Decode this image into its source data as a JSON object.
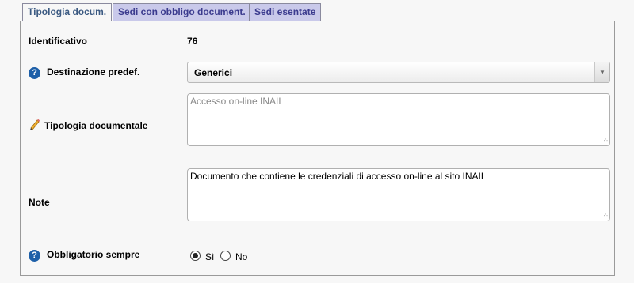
{
  "tabs": [
    {
      "label": "Tipologia docum.",
      "active": true
    },
    {
      "label": "Sedi con obbligo document.",
      "active": false
    },
    {
      "label": "Sedi esentate",
      "active": false
    }
  ],
  "form": {
    "identificativo": {
      "label": "Identificativo",
      "value": "76"
    },
    "destinazione": {
      "label": "Destinazione predef.",
      "value": "Generici",
      "help_icon": "help-icon"
    },
    "tipologia": {
      "label": "Tipologia documentale",
      "placeholder": "Accesso on-line INAIL",
      "icon": "pencil-icon"
    },
    "note": {
      "label": "Note",
      "value": "Documento che contiene le credenziali di accesso on-line al sito INAIL"
    },
    "obbligatorio": {
      "label": "Obbligatorio sempre",
      "options": [
        {
          "label": "Sì",
          "checked": true
        },
        {
          "label": "No",
          "checked": false
        }
      ]
    }
  },
  "colors": {
    "active_tab_text": "#3b5a82",
    "inactive_tab_bg": "#c9c9ea",
    "help_icon": "#1d5fa8"
  }
}
